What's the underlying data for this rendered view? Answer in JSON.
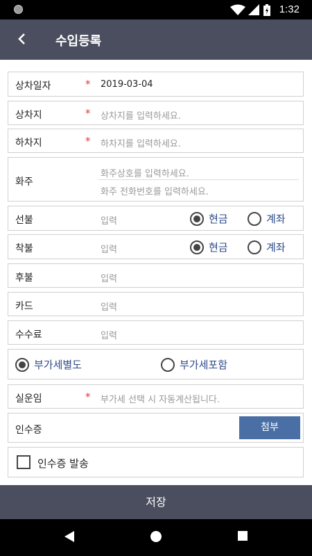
{
  "status_bar": {
    "time": "1:32"
  },
  "appbar": {
    "title": "수입등록"
  },
  "form": {
    "pickup_date": {
      "label": "상차일자",
      "required": "*",
      "value": "2019-03-04"
    },
    "pickup_place": {
      "label": "상차지",
      "required": "*",
      "placeholder": "상차지를 입력하세요."
    },
    "dropoff_place": {
      "label": "하차지",
      "required": "*",
      "placeholder": "하차지를 입력하세요."
    },
    "shipper": {
      "label": "화주",
      "name_placeholder": "화주상호를 입력하세요.",
      "phone_placeholder": "화주 전화번호를 입력하세요."
    },
    "prepaid": {
      "label": "선불",
      "placeholder": "입력",
      "option_cash": "현금",
      "option_account": "계좌",
      "selected": "현금"
    },
    "cod": {
      "label": "착불",
      "placeholder": "입력",
      "option_cash": "현금",
      "option_account": "계좌",
      "selected": "현금"
    },
    "postpaid": {
      "label": "후불",
      "placeholder": "입력"
    },
    "card": {
      "label": "카드",
      "placeholder": "입력"
    },
    "commission": {
      "label": "수수료",
      "placeholder": "입력"
    },
    "vat": {
      "option_separate": "부가세별도",
      "option_included": "부가세포함",
      "selected": "부가세별도"
    },
    "actual_fare": {
      "label": "실운임",
      "required": "*",
      "placeholder": "부가세 선택 시 자동계산됩니다."
    },
    "receipt": {
      "label": "인수증",
      "attach_label": "첨부"
    },
    "send_receipt": {
      "label": "인수증 발송",
      "checked": false
    }
  },
  "save_label": "저장",
  "colors": {
    "appbar": "#4a4e5e",
    "attach_button": "#4a6fa5",
    "required": "#e53935",
    "radio_text": "#2c4a8a"
  }
}
